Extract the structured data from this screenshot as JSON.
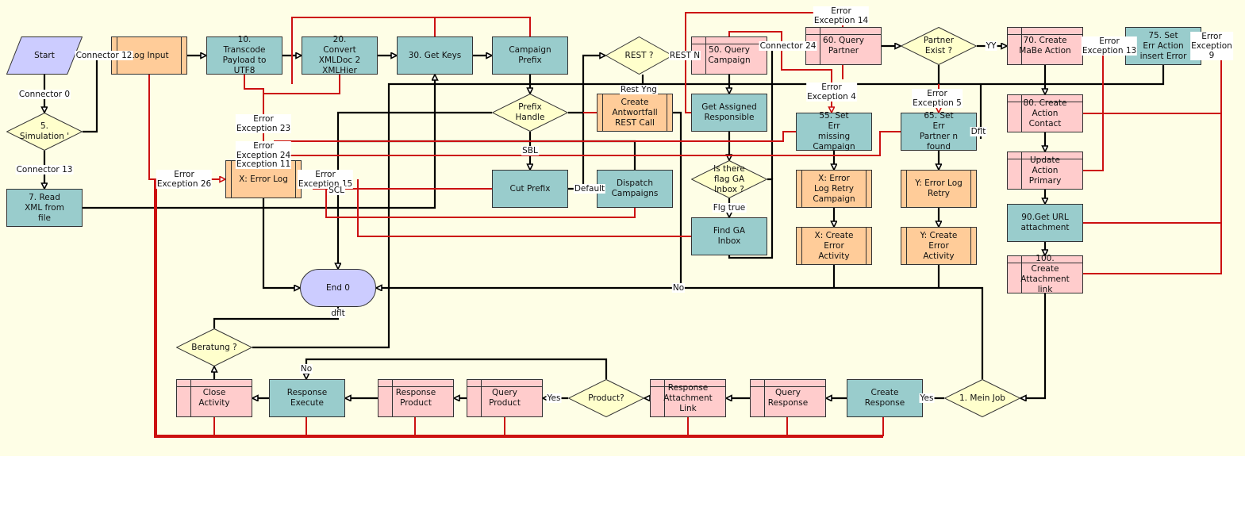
{
  "colors": {
    "canvas": "#fefee6",
    "task": "#99cccc",
    "subprocess": "#ffcc99",
    "siebel_operation": "#ffcccc",
    "decision": "#ffffcc",
    "start_end": "#ccccff",
    "connector": "#000000",
    "error_connector": "#cc1111"
  },
  "nodes": [
    {
      "label": "Start",
      "type": "start"
    },
    {
      "label": "5.\nSimulation '",
      "type": "decision"
    },
    {
      "label": "7. Read\nXML from\nfile",
      "type": "task"
    },
    {
      "label": "Log Input",
      "type": "sub"
    },
    {
      "label": "10.\nTranscode\nPayload to\nUTF8",
      "type": "task"
    },
    {
      "label": "20.\nConvert\nXMLDoc 2\nXMLHier",
      "type": "task"
    },
    {
      "label": "30. Get Keys",
      "type": "task"
    },
    {
      "label": "Campaign\nPrefix",
      "type": "task"
    },
    {
      "label": "REST ?",
      "type": "decision"
    },
    {
      "label": "Prefix\nHandle",
      "type": "decision"
    },
    {
      "label": "Create\nAntwortfall\nREST Call",
      "type": "sub"
    },
    {
      "label": "Cut Prefix",
      "type": "task"
    },
    {
      "label": "Dispatch\nCampaigns",
      "type": "task"
    },
    {
      "label": "X: Error Log",
      "type": "sub"
    },
    {
      "label": "50. Query\nCampaign",
      "type": "op"
    },
    {
      "label": "Get Assigned\nResponsible",
      "type": "task"
    },
    {
      "label": "Is there\nflag GA\nInbox ?",
      "type": "decision"
    },
    {
      "label": "Find GA\nInbox",
      "type": "task"
    },
    {
      "label": "60. Query\nPartner",
      "type": "op"
    },
    {
      "label": "Partner\nExist ?",
      "type": "decision"
    },
    {
      "label": "55. Set\nErr\nmissing\nCampaign",
      "type": "task"
    },
    {
      "label": "65. Set\nErr\nPartner n\nfound",
      "type": "task"
    },
    {
      "label": "X: Error\nLog Retry\nCampaign",
      "type": "sub"
    },
    {
      "label": "X: Create\nError\nActivity",
      "type": "sub"
    },
    {
      "label": "Y: Error Log\nRetry",
      "type": "sub"
    },
    {
      "label": "Y: Create\nError\nActivity",
      "type": "sub"
    },
    {
      "label": "70. Create\nMaBe Action",
      "type": "op"
    },
    {
      "label": "75. Set\nErr Action\ninsert Error",
      "type": "task"
    },
    {
      "label": "80. Create\nAction\nContact",
      "type": "op"
    },
    {
      "label": "Update\nAction\nPrimary",
      "type": "op"
    },
    {
      "label": "90.Get URL\nattachment",
      "type": "task"
    },
    {
      "label": "100.\nCreate\nAttachment\nlink",
      "type": "op"
    },
    {
      "label": "End 0",
      "type": "end"
    },
    {
      "label": "Beratung ?",
      "type": "decision"
    },
    {
      "label": "Close\nActivity",
      "type": "op"
    },
    {
      "label": "Response\nExecute",
      "type": "task"
    },
    {
      "label": "Response\nProduct",
      "type": "op"
    },
    {
      "label": "Query\nProduct",
      "type": "op"
    },
    {
      "label": "Product?",
      "type": "decision"
    },
    {
      "label": "Response\nAttachment\nLink",
      "type": "op"
    },
    {
      "label": "Query\nResponse",
      "type": "op"
    },
    {
      "label": "Create\nResponse",
      "type": "task"
    },
    {
      "label": "1. Mein Job",
      "type": "decision"
    }
  ],
  "edge_labels": [
    "Connector 0",
    "Connector 12",
    "Connector 13",
    "Error\nException 26",
    "Error\nException 23",
    "Error\nException 24",
    "Exception 11",
    "Error\nException 15",
    "SCL",
    "SBL",
    "Default",
    "Rest Yng",
    "REST N",
    "Connector 24",
    "Error\nException 14",
    "Error\nException 4",
    "Error\nException 5",
    "Dflt",
    "YY",
    "Error\nException 13",
    "Error\nException 9",
    "Flg true",
    "No",
    "dflt",
    "No",
    "Yes",
    "Yes"
  ]
}
